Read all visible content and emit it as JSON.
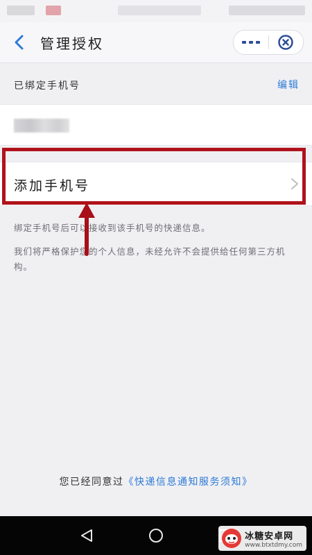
{
  "header": {
    "title": "管理授权",
    "back_icon": "chevron-left-icon",
    "more_icon": "more-dots-icon",
    "close_icon": "miniprogram-close-icon"
  },
  "bound_section": {
    "label": "已绑定手机号",
    "edit_label": "编辑"
  },
  "add_phone": {
    "label": "添加手机号",
    "icon": "chevron-right-icon"
  },
  "notices": [
    "绑定手机号后可以接收到该手机号的快递信息。",
    "我们将严格保护您的个人信息，未经允许不会提供给任何第三方机构。"
  ],
  "footer": {
    "prefix": "您已经同意过",
    "terms_link": "《快递信息通知服务须知》"
  },
  "watermark": {
    "name": "冰糖安卓网",
    "url": "www.btxtdmy.com"
  },
  "colors": {
    "accent": "#2d7ad6",
    "highlight": "#b0121b",
    "background": "#f0f0f3"
  }
}
